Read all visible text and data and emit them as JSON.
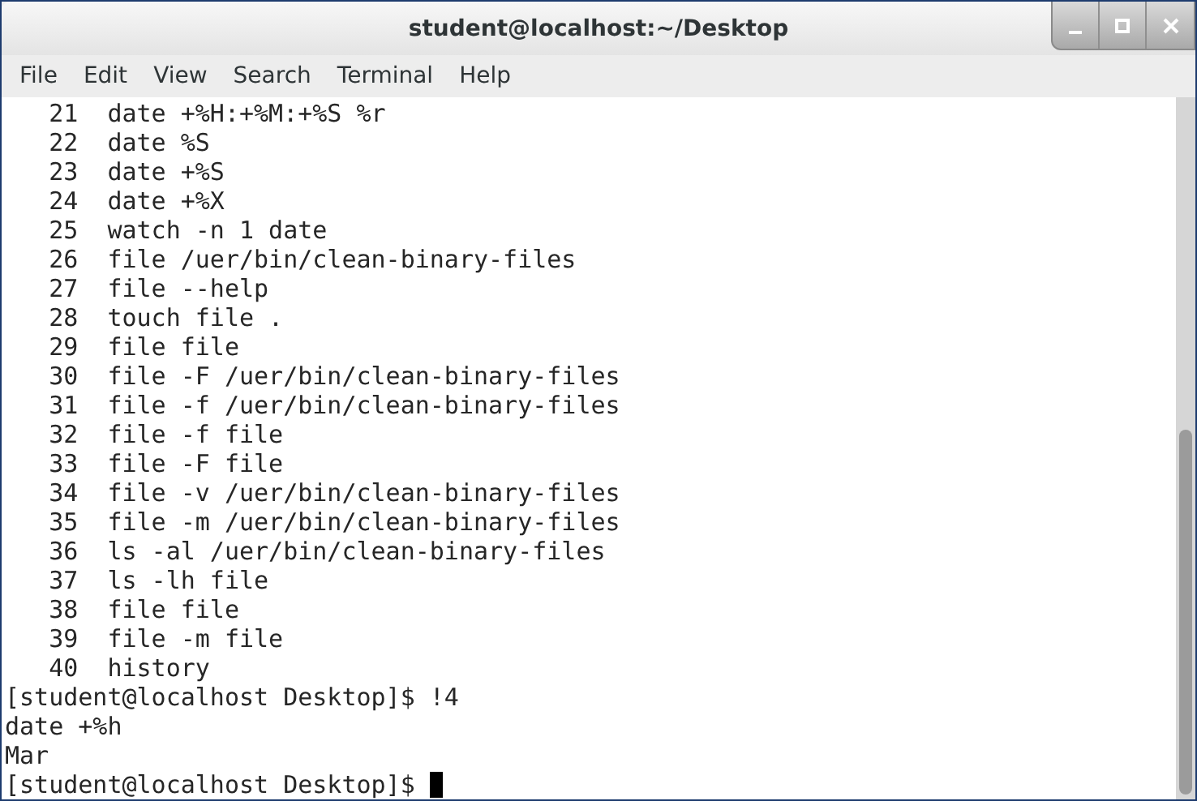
{
  "window": {
    "title": "student@localhost:~/Desktop"
  },
  "menu": [
    {
      "label": "File"
    },
    {
      "label": "Edit"
    },
    {
      "label": "View"
    },
    {
      "label": "Search"
    },
    {
      "label": "Terminal"
    },
    {
      "label": "Help"
    }
  ],
  "terminal": {
    "lines": [
      "   21  date +%H:+%M:+%S %r",
      "   22  date %S",
      "   23  date +%S",
      "   24  date +%X",
      "   25  watch -n 1 date",
      "   26  file /uer/bin/clean-binary-files",
      "   27  file --help",
      "   28  touch file .",
      "   29  file file",
      "   30  file -F /uer/bin/clean-binary-files",
      "   31  file -f /uer/bin/clean-binary-files",
      "   32  file -f file",
      "   33  file -F file",
      "   34  file -v /uer/bin/clean-binary-files",
      "   35  file -m /uer/bin/clean-binary-files",
      "   36  ls -al /uer/bin/clean-binary-files",
      "   37  ls -lh file",
      "   38  file file",
      "   39  file -m file",
      "   40  history",
      "[student@localhost Desktop]$ !4",
      "date +%h",
      "Mar"
    ],
    "prompt": "[student@localhost Desktop]$ "
  }
}
